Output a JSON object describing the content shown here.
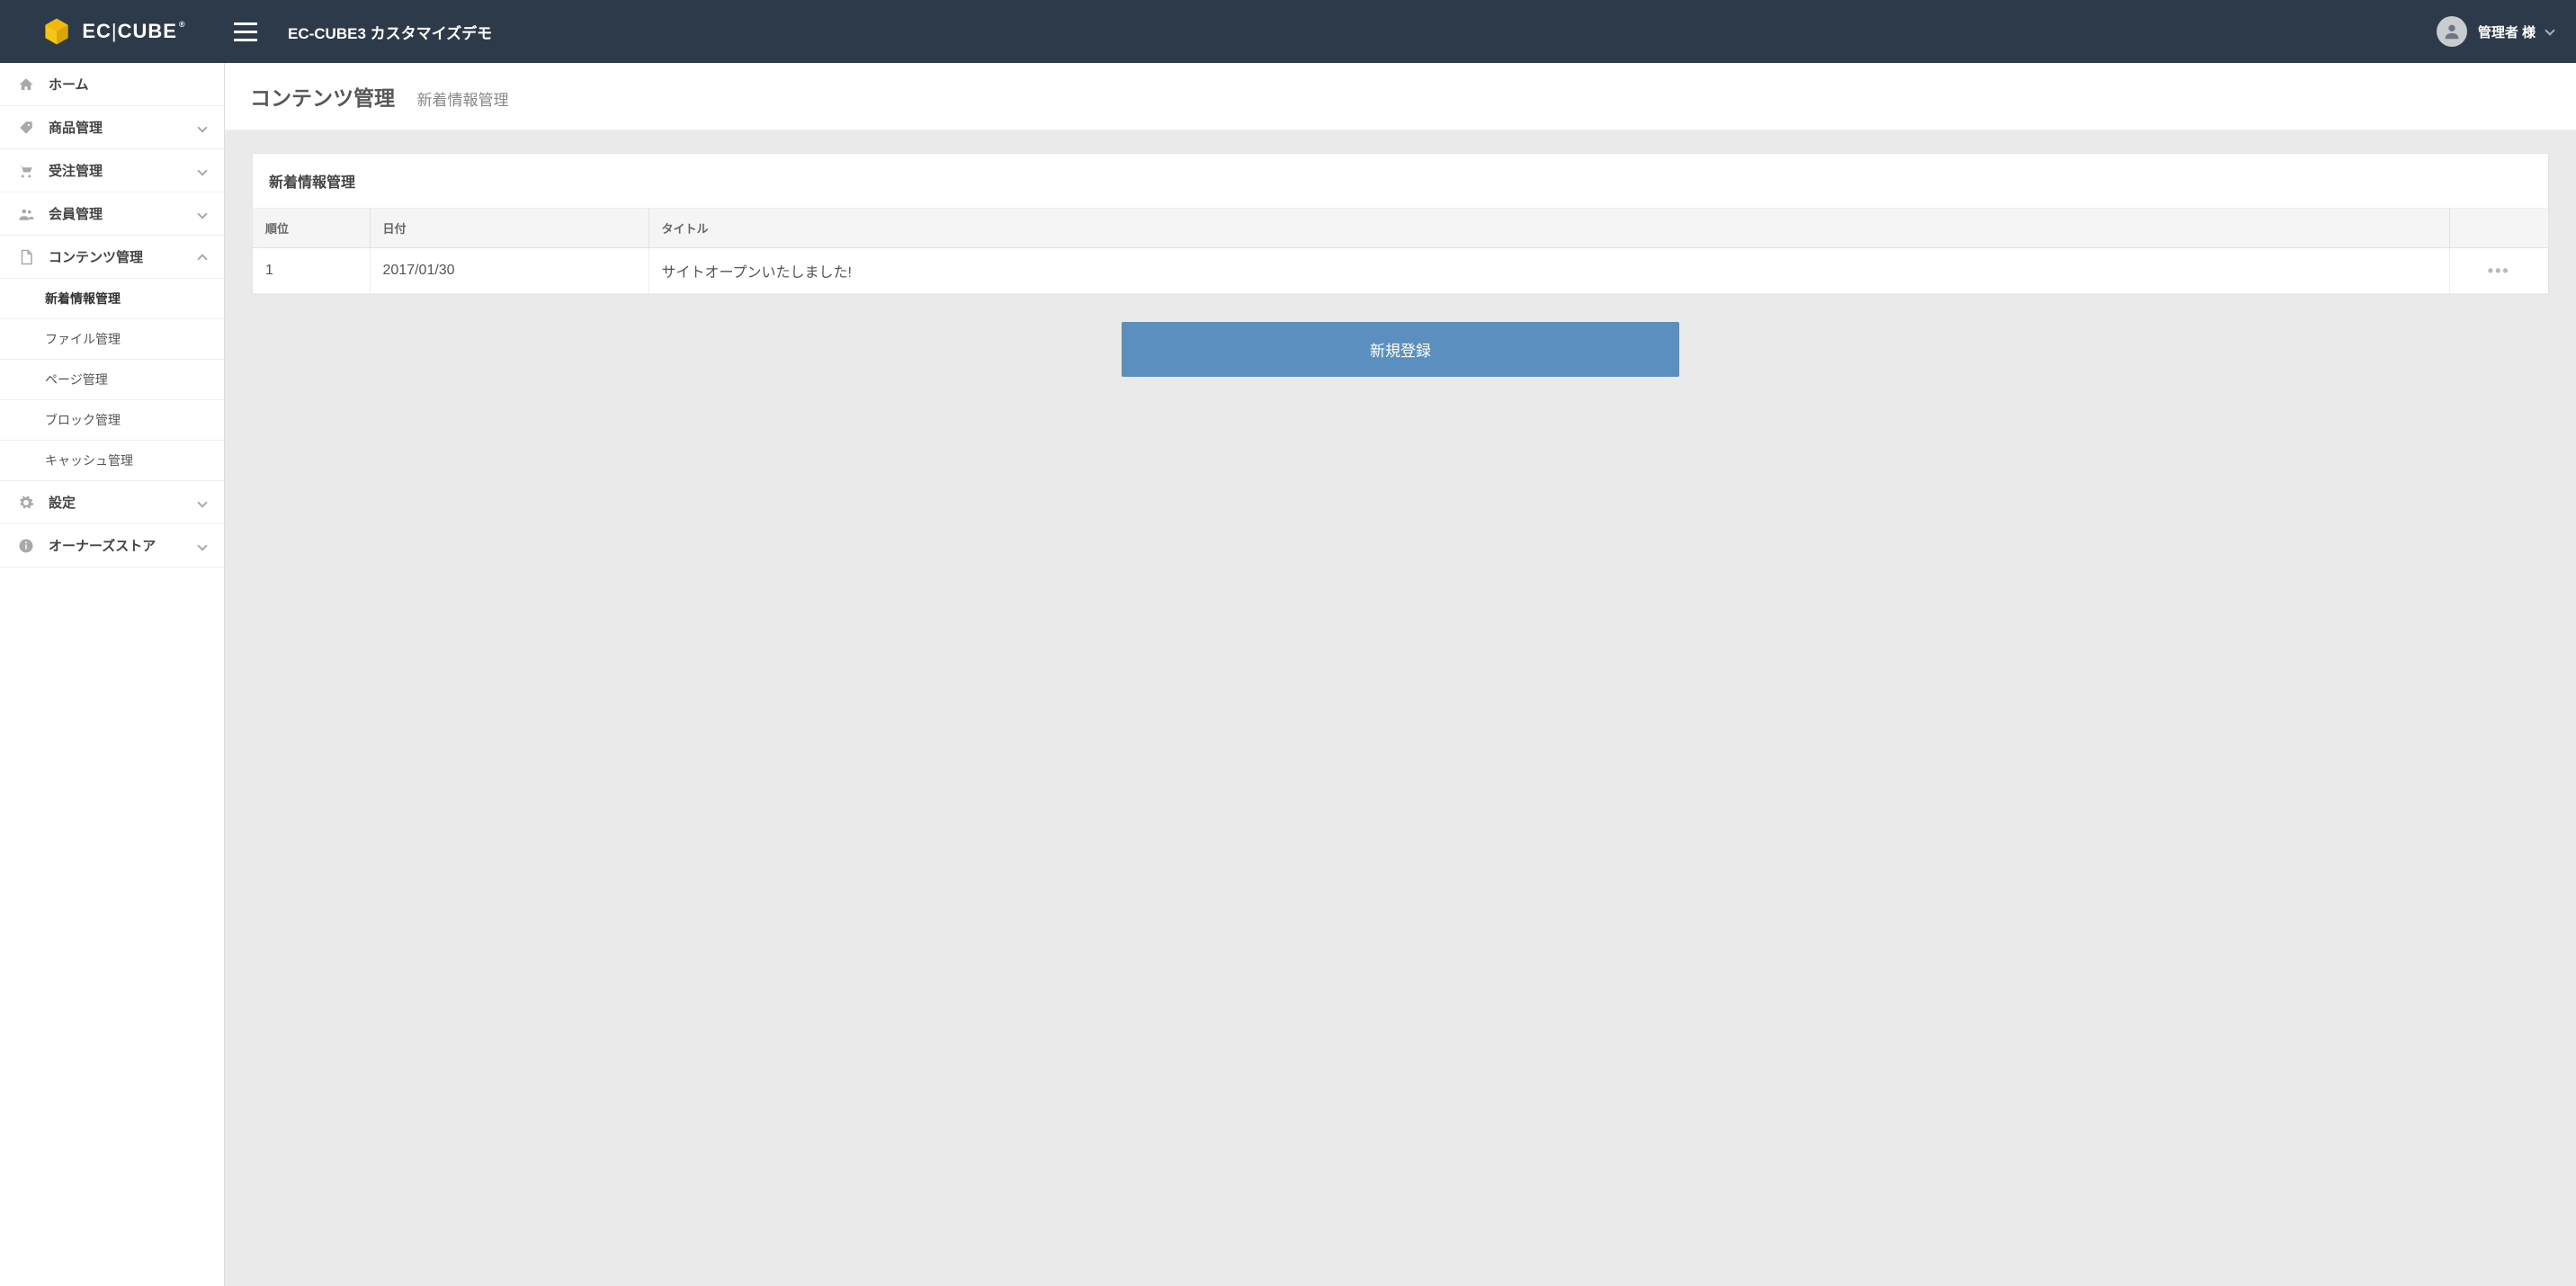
{
  "logo": {
    "brand": "EC",
    "brand2": "CUBE",
    "reg": "®"
  },
  "header": {
    "title": "EC-CUBE3 カスタマイズデモ"
  },
  "user": {
    "name": "管理者 様"
  },
  "sidebar": {
    "items": [
      {
        "label": "ホーム"
      },
      {
        "label": "商品管理"
      },
      {
        "label": "受注管理"
      },
      {
        "label": "会員管理"
      },
      {
        "label": "コンテンツ管理"
      },
      {
        "label": "設定"
      },
      {
        "label": "オーナーズストア"
      }
    ],
    "subitems": [
      {
        "label": "新着情報管理"
      },
      {
        "label": "ファイル管理"
      },
      {
        "label": "ページ管理"
      },
      {
        "label": "ブロック管理"
      },
      {
        "label": "キャッシュ管理"
      }
    ]
  },
  "crumb": {
    "title": "コンテンツ管理",
    "sub": "新着情報管理"
  },
  "panel": {
    "title": "新着情報管理"
  },
  "table": {
    "headers": {
      "rank": "順位",
      "date": "日付",
      "title": "タイトル",
      "actions": ""
    },
    "rows": [
      {
        "rank": "1",
        "date": "2017/01/30",
        "title": "サイトオープンいたしました!"
      }
    ]
  },
  "buttons": {
    "new": "新規登録"
  }
}
